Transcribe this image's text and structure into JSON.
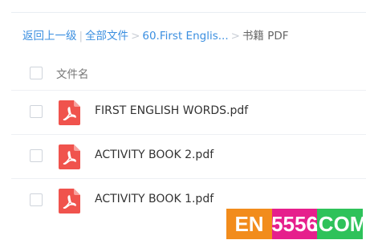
{
  "breadcrumb": {
    "back": "返回上一级",
    "separator": "|",
    "all_files": "全部文件",
    "arrow": ">",
    "folder": "60.First Englis...",
    "current": "书籍 PDF"
  },
  "table": {
    "column_filename": "文件名"
  },
  "files": [
    {
      "name": "FIRST ENGLISH WORDS.pdf",
      "icon": "pdf-icon"
    },
    {
      "name": "ACTIVITY BOOK 2.pdf",
      "icon": "pdf-icon"
    },
    {
      "name": "ACTIVITY BOOK 1.pdf",
      "icon": "pdf-icon"
    }
  ],
  "watermark": {
    "part1": "EN",
    "part2": "5556",
    "part3": ".COM"
  },
  "colors": {
    "link": "#3b8fe0",
    "pdf_icon": "#f0534d"
  }
}
